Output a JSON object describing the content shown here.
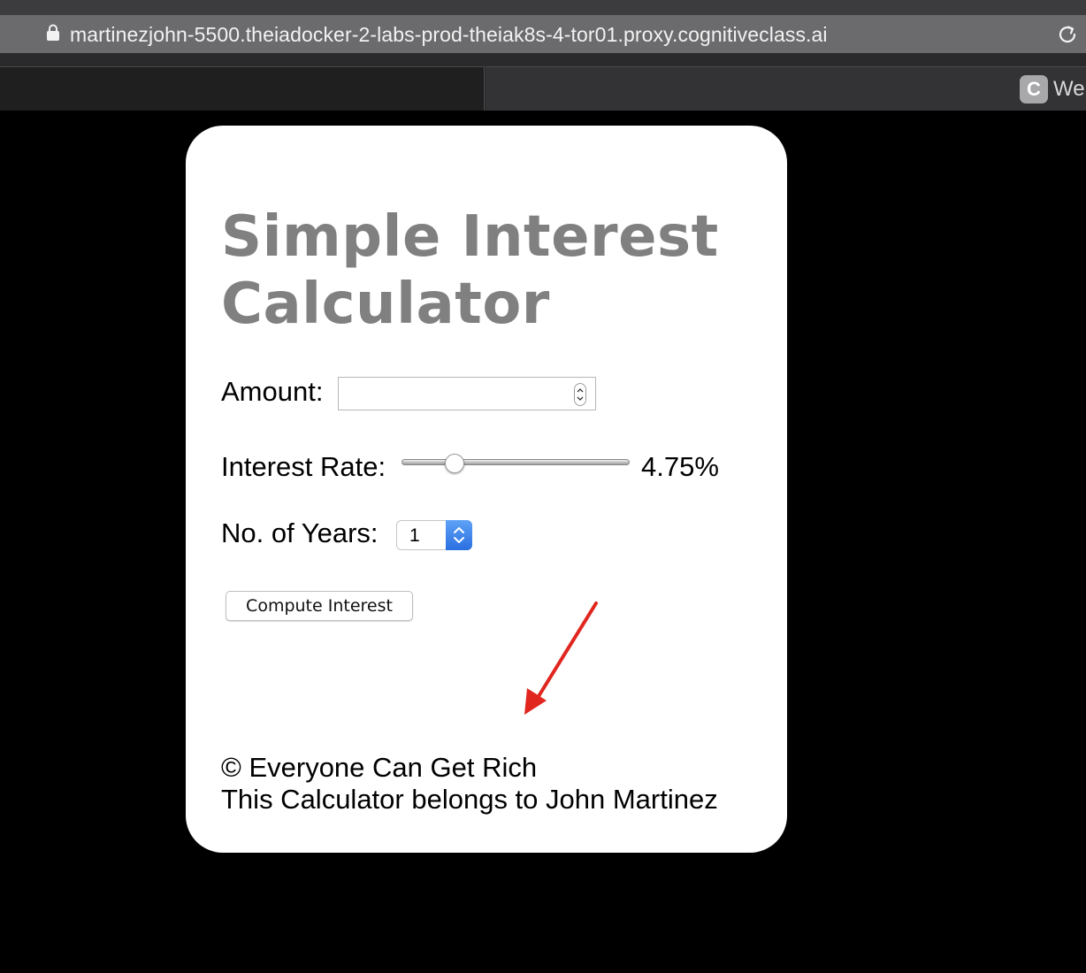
{
  "browser": {
    "url": "martinezjohn-5500.theiadocker-2-labs-prod-theiak8s-4-tor01.proxy.cognitiveclass.ai",
    "tab_favicon_letter": "C",
    "tab_title": "Wel"
  },
  "calculator": {
    "title": "Simple Interest Calculator",
    "amount_label": "Amount:",
    "amount_value": "",
    "rate_label": "Interest Rate:",
    "rate_value": 4.75,
    "rate_display": "4.75%",
    "years_label": "No. of Years:",
    "years_selected": "1",
    "compute_button_label": "Compute Interest",
    "footer_line1": "© Everyone Can Get Rich",
    "footer_line2": "This Calculator belongs to John Martinez"
  },
  "colors": {
    "title": "#808080",
    "card_background": "#ffffff",
    "page_background": "#000000",
    "annotation_arrow": "#e0261f",
    "select_accent": "#2a6fe0"
  },
  "icons": [
    "lock-icon",
    "reload-icon",
    "stepper-icon",
    "chevron-updown-icon",
    "annotation-arrow-icon"
  ]
}
